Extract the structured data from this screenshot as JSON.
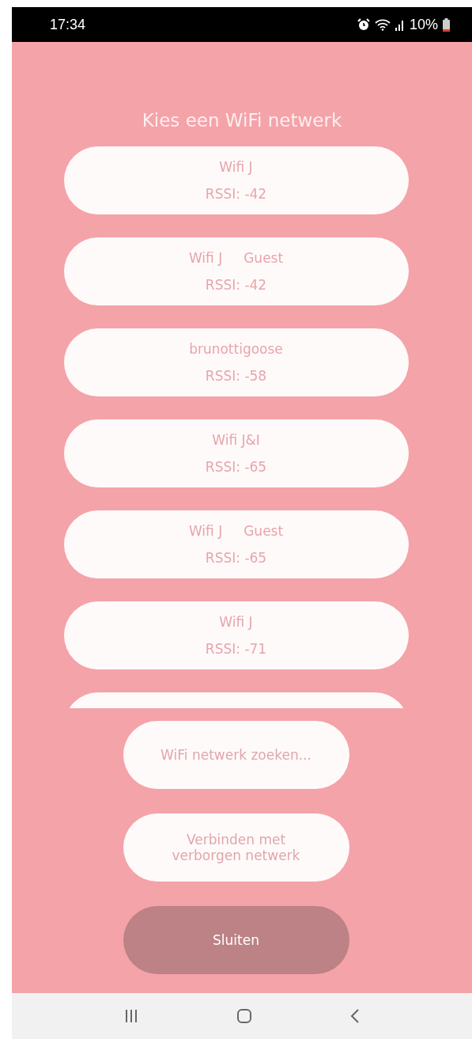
{
  "status_bar": {
    "time": "17:34",
    "battery": "10%"
  },
  "dialog": {
    "title": "Kies een WiFi netwerk",
    "networks": [
      {
        "kind": "full",
        "name": "Wifi J",
        "rssi": "RSSI: -42"
      },
      {
        "kind": "full",
        "name": "Wifi J     Guest",
        "rssi": "RSSI: -42"
      },
      {
        "kind": "full",
        "name": "brunottigoose",
        "rssi": "RSSI: -58"
      },
      {
        "kind": "full",
        "name": "Wifi J&I",
        "rssi": "RSSI: -65"
      },
      {
        "kind": "full",
        "name": "Wifi J     Guest",
        "rssi": "RSSI: -65"
      },
      {
        "kind": "full",
        "name": "Wifi J",
        "rssi": "RSSI: -71"
      },
      {
        "kind": "cut"
      }
    ],
    "buttons": [
      {
        "label": "WiFi netwerk zoeken...",
        "kind": "light"
      },
      {
        "label": "Verbinden met verborgen netwerk",
        "kind": "light"
      },
      {
        "label": "Sluiten",
        "kind": "dark"
      }
    ]
  }
}
